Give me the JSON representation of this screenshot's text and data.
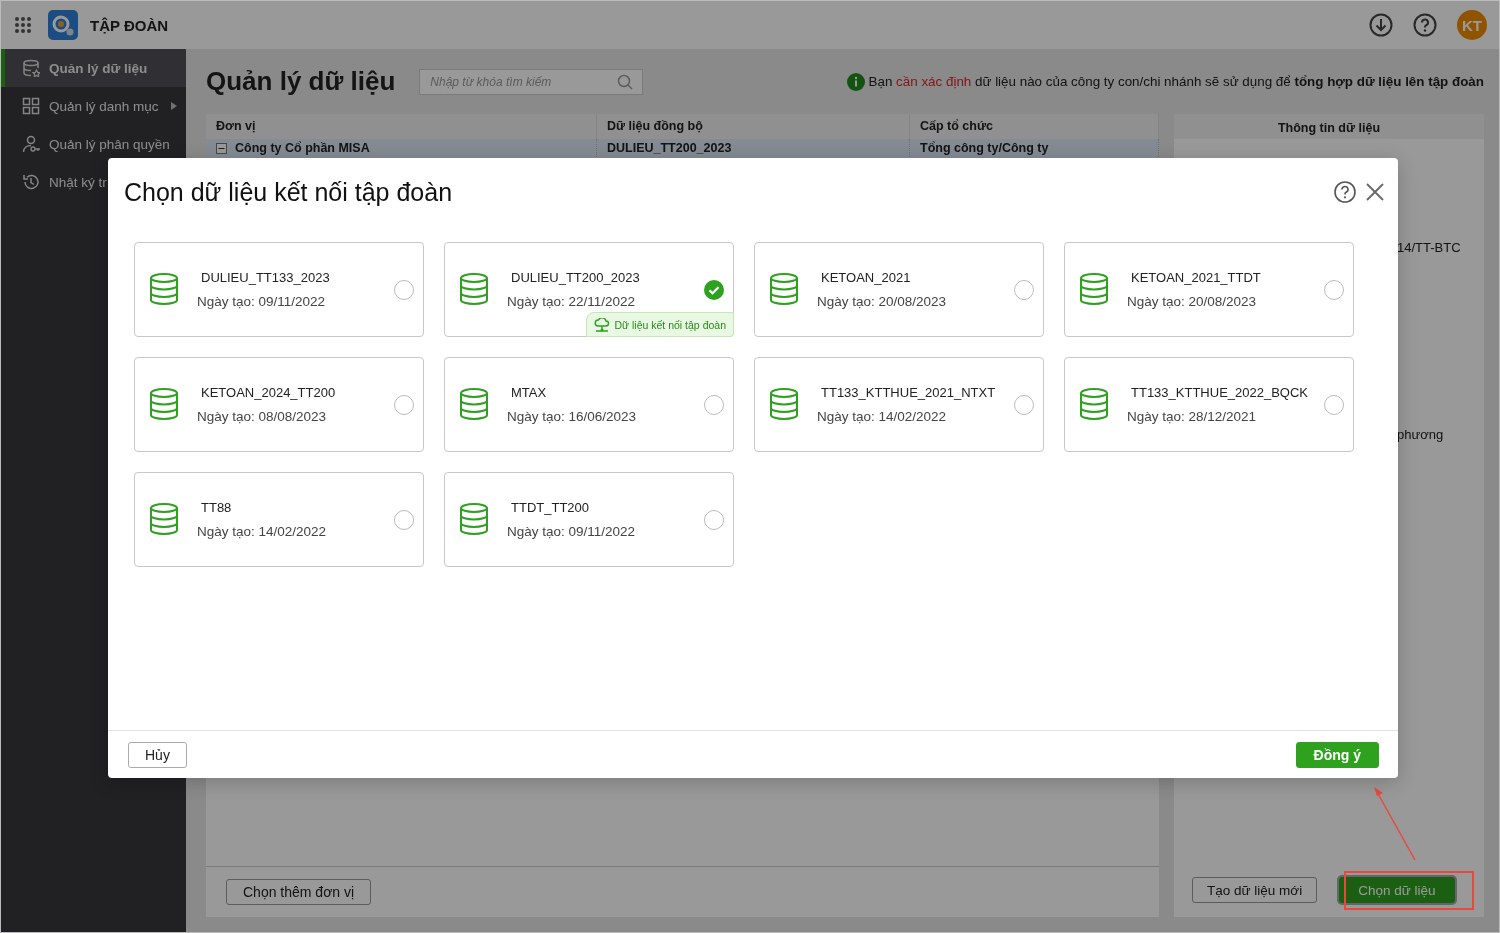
{
  "app": {
    "title": "TẬP ĐOÀN",
    "avatar": "KT"
  },
  "sidebar": {
    "items": [
      {
        "label": "Quản lý dữ liệu",
        "kind": "database",
        "selected": true,
        "has_submenu": false
      },
      {
        "label": "Quản lý danh mục",
        "kind": "grid",
        "selected": false,
        "has_submenu": true
      },
      {
        "label": "Quản lý phân quyền",
        "kind": "user",
        "selected": false,
        "has_submenu": false
      },
      {
        "label": "Nhật ký tr",
        "kind": "history",
        "selected": false,
        "has_submenu": false
      }
    ]
  },
  "page": {
    "title": "Quản lý dữ liệu",
    "search": {
      "placeholder": "Nhập từ khóa tìm kiếm"
    },
    "notice": [
      {
        "text": "Bạn ",
        "kind": "plain"
      },
      {
        "text": "cần xác định",
        "kind": "alert"
      },
      {
        "text": " dữ liệu nào của công ty con/chi nhánh sẽ sử dụng để ",
        "kind": "plain"
      },
      {
        "text": "tổng hợp dữ liệu lên tập đoàn",
        "kind": "strong"
      }
    ]
  },
  "table": {
    "columns": [
      "Đơn vị",
      "Dữ liệu đồng bộ",
      "Cấp tổ chức"
    ],
    "rows": [
      {
        "cells": [
          "Công ty Cổ phần MISA",
          "DULIEU_TT200_2023",
          "Tổng công ty/Công ty"
        ],
        "selected": true,
        "expanded": true
      }
    ],
    "footer_button": "Chọn thêm đơn vị"
  },
  "details": {
    "title": "Thông tin dữ liệu",
    "fragments": [
      "14/TT-BTC",
      "phương"
    ],
    "buttons": [
      {
        "label": "Tạo dữ liệu mới",
        "kind": "secondary",
        "highlighted": false
      },
      {
        "label": "Chọn dữ liệu",
        "kind": "primary",
        "highlighted": true
      }
    ]
  },
  "dialog": {
    "title": "Chọn dữ liệu kết nối tập đoàn",
    "items": [
      {
        "name": "DULIEU_TT133_2023",
        "created": "Ngày tạo: 09/11/2022",
        "selected": false
      },
      {
        "name": "DULIEU_TT200_2023",
        "created": "Ngày tạo: 22/11/2022",
        "selected": true,
        "badge": "Dữ liệu kết nối tập đoàn"
      },
      {
        "name": "KETOAN_2021",
        "created": "Ngày tạo: 20/08/2023",
        "selected": false
      },
      {
        "name": "KETOAN_2021_TTDT",
        "created": "Ngày tạo: 20/08/2023",
        "selected": false
      },
      {
        "name": "KETOAN_2024_TT200",
        "created": "Ngày tạo: 08/08/2023",
        "selected": false
      },
      {
        "name": "MTAX",
        "created": "Ngày tạo: 16/06/2023",
        "selected": false
      },
      {
        "name": "TT133_KTTHUE_2021_NTXT",
        "created": "Ngày tạo: 14/02/2022",
        "selected": false
      },
      {
        "name": "TT133_KTTHUE_2022_BQCK",
        "created": "Ngày tạo: 28/12/2021",
        "selected": false
      },
      {
        "name": "TT88",
        "created": "Ngày tạo: 14/02/2022",
        "selected": false
      },
      {
        "name": "TTDT_TT200",
        "created": "Ngày tạo: 09/11/2022",
        "selected": false
      }
    ],
    "cancel": "Hủy",
    "ok": "Đồng ý"
  }
}
